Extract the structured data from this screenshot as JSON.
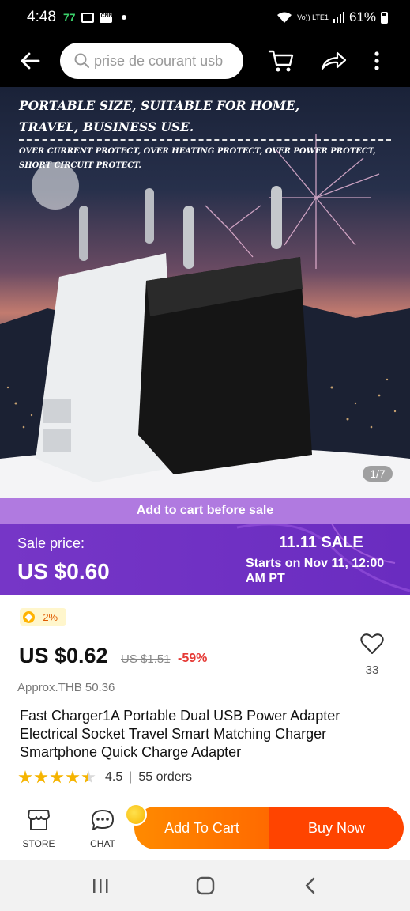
{
  "status_bar": {
    "time": "4:48",
    "carrier_badge": "77",
    "network": "Vo)) LTE1",
    "battery": "61%"
  },
  "header": {
    "search_placeholder": "prise de courant usb",
    "icons": [
      "back-arrow-icon",
      "search-icon",
      "cart-icon",
      "share-icon",
      "more-icon"
    ]
  },
  "gallery": {
    "headline": "PORTABLE SIZE, SUITABLE FOR HOME, TRAVEL, BUSINESS USE.",
    "subline": "OVER CURRENT PROTECT, OVER HEATING PROTECT, OVER POWER PROTECT, SHORT CIRCUIT PROTECT.",
    "page_indicator": "1/7"
  },
  "sale": {
    "strip_text": "Add to cart before sale",
    "price_label": "Sale price:",
    "price": "US $0.60",
    "event_title": "11.11 SALE",
    "start_text": "Starts on Nov 11, 12:00 AM PT",
    "accent": "#6f31c4"
  },
  "product": {
    "coupon": "-2%",
    "price": "US $0.62",
    "original_price": "US $1.51",
    "discount": "-59%",
    "wishlist_count": "33",
    "approx": "Approx.THB 50.36",
    "title": "Fast Charger1A Portable Dual USB Power Adapter Electrical Socket Travel Smart Matching Charger Smartphone Quick Charge Adapter",
    "rating": "4.5",
    "rating_stars": 4.5,
    "orders": "55 orders"
  },
  "bottom_bar": {
    "store_label": "STORE",
    "chat_label": "CHAT",
    "add_to_cart": "Add To Cart",
    "buy_now": "Buy Now"
  }
}
